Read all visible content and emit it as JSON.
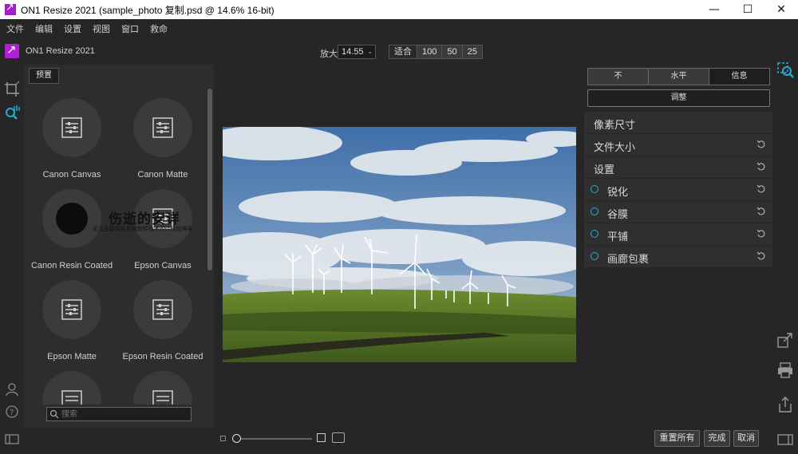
{
  "window": {
    "title": "ON1 Resize 2021 (sample_photo 复制.psd @ 14.6% 16-bit)",
    "minimize": "—",
    "maximize": "☐",
    "close": "✕"
  },
  "menu": [
    "文件",
    "编辑",
    "设置",
    "视图",
    "窗口",
    "救命"
  ],
  "brand": {
    "name": "ON1 Resize 2021"
  },
  "zoom": {
    "label": "放大",
    "value": "14.55",
    "presets": [
      "适合",
      "100",
      "50",
      "25"
    ]
  },
  "presets_panel": {
    "tab": "预置",
    "items": [
      {
        "label": "Canon Canvas"
      },
      {
        "label": "Canon Matte"
      },
      {
        "label": "Canon Resin Coated"
      },
      {
        "label": "Epson Canvas"
      },
      {
        "label": "Epson Matte"
      },
      {
        "label": "Epson Resin Coated"
      }
    ],
    "search_placeholder": "搜索"
  },
  "watermark": {
    "title": "伤逝的安详",
    "subtitle": "关注互联网与系统软件技术的IT科技博客"
  },
  "right_panel": {
    "segments": [
      "不",
      "水平",
      "信息"
    ],
    "adjust": "调整",
    "sections": [
      {
        "label": "像素尺寸"
      },
      {
        "label": "文件大小"
      },
      {
        "label": "设置"
      },
      {
        "label": "锐化"
      },
      {
        "label": "谷膜"
      },
      {
        "label": "平铺"
      },
      {
        "label": "画廊包裹"
      }
    ]
  },
  "bottom": {
    "reset_all": "重置所有",
    "done": "完成",
    "cancel": "取消"
  },
  "colors": {
    "accent": "#2aa8d8",
    "brand": "#b020d8",
    "background": "#262626"
  }
}
